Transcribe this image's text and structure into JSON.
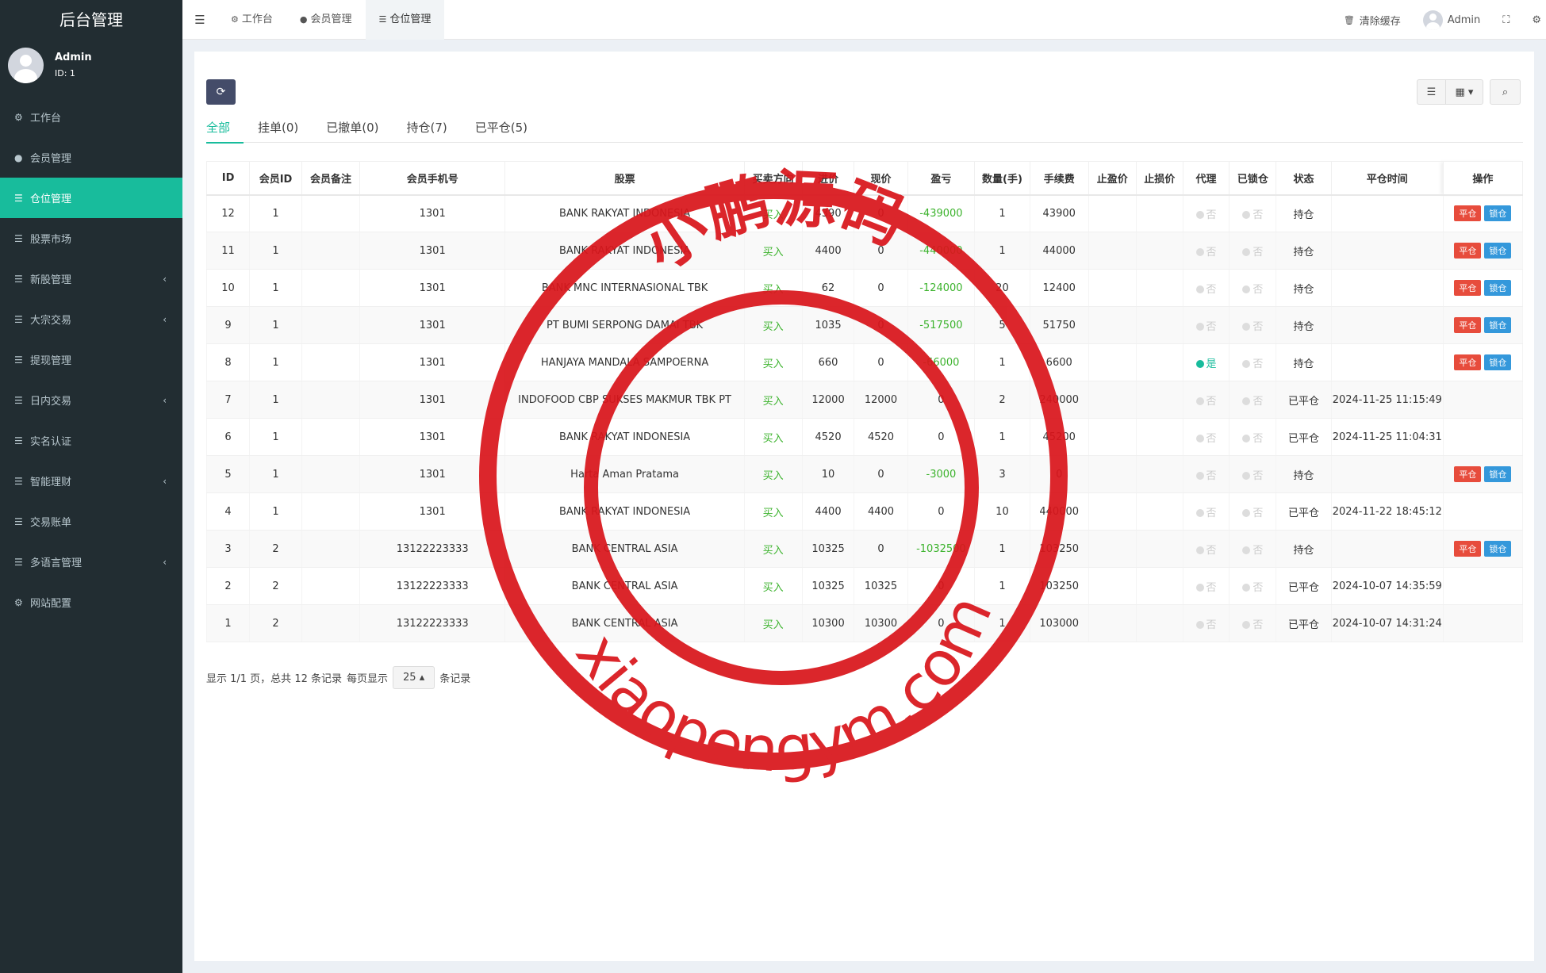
{
  "app": {
    "title": "后台管理",
    "user": {
      "name": "Admin",
      "id_text": "ID: 1"
    }
  },
  "sidebar": {
    "items": [
      {
        "label": "工作台",
        "icon": "dashboard-icon",
        "glyph": "⚙",
        "active": false,
        "has_arrow": false
      },
      {
        "label": "会员管理",
        "icon": "user-circle-icon",
        "glyph": "●",
        "active": false,
        "has_arrow": false
      },
      {
        "label": "仓位管理",
        "icon": "list-icon",
        "glyph": "☰",
        "active": true,
        "has_arrow": false
      },
      {
        "label": "股票市场",
        "icon": "list-icon",
        "glyph": "☰",
        "active": false,
        "has_arrow": false
      },
      {
        "label": "新股管理",
        "icon": "list-icon",
        "glyph": "☰",
        "active": false,
        "has_arrow": true
      },
      {
        "label": "大宗交易",
        "icon": "list-icon",
        "glyph": "☰",
        "active": false,
        "has_arrow": true
      },
      {
        "label": "提现管理",
        "icon": "list-icon",
        "glyph": "☰",
        "active": false,
        "has_arrow": false
      },
      {
        "label": "日内交易",
        "icon": "list-icon",
        "glyph": "☰",
        "active": false,
        "has_arrow": true
      },
      {
        "label": "实名认证",
        "icon": "list-icon",
        "glyph": "☰",
        "active": false,
        "has_arrow": false
      },
      {
        "label": "智能理财",
        "icon": "list-icon",
        "glyph": "☰",
        "active": false,
        "has_arrow": true
      },
      {
        "label": "交易账单",
        "icon": "list-icon",
        "glyph": "☰",
        "active": false,
        "has_arrow": false
      },
      {
        "label": "多语言管理",
        "icon": "list-icon",
        "glyph": "☰",
        "active": false,
        "has_arrow": true
      },
      {
        "label": "网站配置",
        "icon": "gears-icon",
        "glyph": "⚙",
        "active": false,
        "has_arrow": false
      }
    ]
  },
  "navbar": {
    "tabs": [
      {
        "label": "工作台",
        "icon": "dashboard-icon",
        "glyph": "⚙",
        "active": false
      },
      {
        "label": "会员管理",
        "icon": "user-circle-icon",
        "glyph": "●",
        "active": false
      },
      {
        "label": "仓位管理",
        "icon": "list-icon",
        "glyph": "☰",
        "active": true
      }
    ],
    "clear_cache": "清除缓存",
    "user_name": "Admin"
  },
  "filter_tabs": [
    "全部",
    "挂单(0)",
    "已撤单(0)",
    "持仓(7)",
    "已平仓(5)"
  ],
  "table": {
    "columns": [
      "ID",
      "会员ID",
      "会员备注",
      "会员手机号",
      "股票",
      "买卖方向",
      "进价",
      "现价",
      "盈亏",
      "数量(手)",
      "手续费",
      "止盈价",
      "止损价",
      "代理",
      "已锁仓",
      "状态",
      "平仓时间",
      "操作"
    ],
    "flag_no": "否",
    "flag_yes": "是",
    "btn_close": "平仓",
    "btn_lock": "锁仓",
    "rows": [
      {
        "id": "12",
        "member_id": "1",
        "remark": "",
        "phone": "1301",
        "stock": "BANK RAKYAT INDONESIA",
        "direction": "买入",
        "buy_price": "4390",
        "current_price": "0",
        "pnl": "-439000",
        "qty": "1",
        "fee": "43900",
        "tp": "",
        "sl": "",
        "agent": false,
        "locked": false,
        "status": "持仓",
        "close_time": "",
        "ops": true
      },
      {
        "id": "11",
        "member_id": "1",
        "remark": "",
        "phone": "1301",
        "stock": "BANK RAKYAT INDONESIA",
        "direction": "买入",
        "buy_price": "4400",
        "current_price": "0",
        "pnl": "-440000",
        "qty": "1",
        "fee": "44000",
        "tp": "",
        "sl": "",
        "agent": false,
        "locked": false,
        "status": "持仓",
        "close_time": "",
        "ops": true
      },
      {
        "id": "10",
        "member_id": "1",
        "remark": "",
        "phone": "1301",
        "stock": "BANK MNC INTERNASIONAL TBK",
        "direction": "买入",
        "buy_price": "62",
        "current_price": "0",
        "pnl": "-124000",
        "qty": "20",
        "fee": "12400",
        "tp": "",
        "sl": "",
        "agent": false,
        "locked": false,
        "status": "持仓",
        "close_time": "",
        "ops": true
      },
      {
        "id": "9",
        "member_id": "1",
        "remark": "",
        "phone": "1301",
        "stock": "PT BUMI SERPONG DAMAI TBK",
        "direction": "买入",
        "buy_price": "1035",
        "current_price": "0",
        "pnl": "-517500",
        "qty": "5",
        "fee": "51750",
        "tp": "",
        "sl": "",
        "agent": false,
        "locked": false,
        "status": "持仓",
        "close_time": "",
        "ops": true
      },
      {
        "id": "8",
        "member_id": "1",
        "remark": "",
        "phone": "1301",
        "stock": "HANJAYA MANDALA SAMPOERNA",
        "direction": "买入",
        "buy_price": "660",
        "current_price": "0",
        "pnl": "-66000",
        "qty": "1",
        "fee": "6600",
        "tp": "",
        "sl": "",
        "agent": true,
        "locked": false,
        "status": "持仓",
        "close_time": "",
        "ops": true
      },
      {
        "id": "7",
        "member_id": "1",
        "remark": "",
        "phone": "1301",
        "stock": "INDOFOOD CBP SUKSES MAKMUR TBK PT",
        "direction": "买入",
        "buy_price": "12000",
        "current_price": "12000",
        "pnl": "0",
        "qty": "2",
        "fee": "240000",
        "tp": "",
        "sl": "",
        "agent": false,
        "locked": false,
        "status": "已平仓",
        "close_time": "2024-11-25 11:15:49",
        "ops": false
      },
      {
        "id": "6",
        "member_id": "1",
        "remark": "",
        "phone": "1301",
        "stock": "BANK RAKYAT INDONESIA",
        "direction": "买入",
        "buy_price": "4520",
        "current_price": "4520",
        "pnl": "0",
        "qty": "1",
        "fee": "45200",
        "tp": "",
        "sl": "",
        "agent": false,
        "locked": false,
        "status": "已平仓",
        "close_time": "2024-11-25 11:04:31",
        "ops": false
      },
      {
        "id": "5",
        "member_id": "1",
        "remark": "",
        "phone": "1301",
        "stock": "Harta Aman Pratama",
        "direction": "买入",
        "buy_price": "10",
        "current_price": "0",
        "pnl": "-3000",
        "qty": "3",
        "fee": "0",
        "tp": "",
        "sl": "",
        "agent": false,
        "locked": false,
        "status": "持仓",
        "close_time": "",
        "ops": true
      },
      {
        "id": "4",
        "member_id": "1",
        "remark": "",
        "phone": "1301",
        "stock": "BANK RAKYAT INDONESIA",
        "direction": "买入",
        "buy_price": "4400",
        "current_price": "4400",
        "pnl": "0",
        "qty": "10",
        "fee": "440000",
        "tp": "",
        "sl": "",
        "agent": false,
        "locked": false,
        "status": "已平仓",
        "close_time": "2024-11-22 18:45:12",
        "ops": false
      },
      {
        "id": "3",
        "member_id": "2",
        "remark": "",
        "phone": "13122223333",
        "stock": "BANK CENTRAL ASIA",
        "direction": "买入",
        "buy_price": "10325",
        "current_price": "0",
        "pnl": "-1032500",
        "qty": "1",
        "fee": "103250",
        "tp": "",
        "sl": "",
        "agent": false,
        "locked": false,
        "status": "持仓",
        "close_time": "",
        "ops": true
      },
      {
        "id": "2",
        "member_id": "2",
        "remark": "",
        "phone": "13122223333",
        "stock": "BANK CENTRAL ASIA",
        "direction": "买入",
        "buy_price": "10325",
        "current_price": "10325",
        "pnl": "0",
        "qty": "1",
        "fee": "103250",
        "tp": "",
        "sl": "",
        "agent": false,
        "locked": false,
        "status": "已平仓",
        "close_time": "2024-10-07 14:35:59",
        "ops": false
      },
      {
        "id": "1",
        "member_id": "2",
        "remark": "",
        "phone": "13122223333",
        "stock": "BANK CENTRAL ASIA",
        "direction": "买入",
        "buy_price": "10300",
        "current_price": "10300",
        "pnl": "0",
        "qty": "1",
        "fee": "103000",
        "tp": "",
        "sl": "",
        "agent": false,
        "locked": false,
        "status": "已平仓",
        "close_time": "2024-10-07 14:31:24",
        "ops": false
      }
    ]
  },
  "pager": {
    "summary": "显示 1/1 页，总共 12 条记录",
    "per_page_label": "每页显示",
    "per_page_value": "25",
    "records_label": "条记录"
  },
  "watermark": {
    "top_text": "小鹏源码",
    "bottom_text": "xiaopengym.com",
    "color": "#d9161c"
  },
  "colors": {
    "sidebar_bg": "#222d32",
    "accent": "#18bc9c",
    "buy_green": "#3cb32d",
    "close_red": "#e74c3c",
    "lock_blue": "#3498db"
  }
}
